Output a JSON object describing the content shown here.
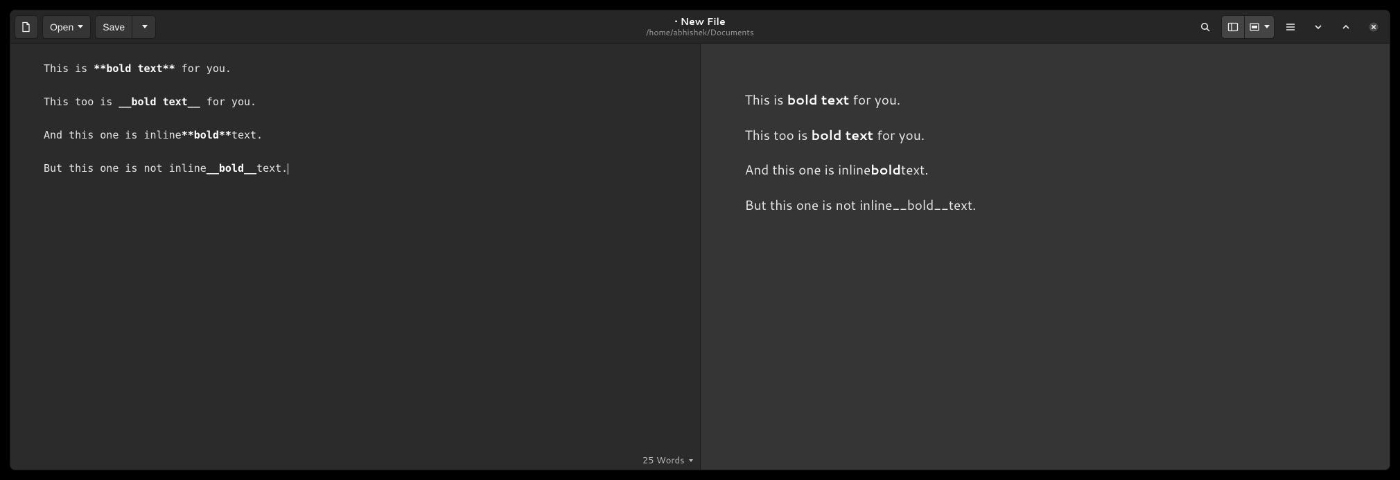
{
  "header": {
    "open_label": "Open",
    "save_label": "Save",
    "title": "• New File",
    "subtitle": "/home/abhishek/Documents"
  },
  "editor": {
    "lines": [
      {
        "segments": [
          {
            "t": "This is ",
            "s": "plain"
          },
          {
            "t": "**",
            "s": "delim"
          },
          {
            "t": "bold text",
            "s": "bold"
          },
          {
            "t": "**",
            "s": "delim"
          },
          {
            "t": " for you.",
            "s": "plain"
          }
        ]
      },
      {
        "segments": []
      },
      {
        "segments": [
          {
            "t": "This too is ",
            "s": "plain"
          },
          {
            "t": "__",
            "s": "delim"
          },
          {
            "t": "bold text",
            "s": "bold"
          },
          {
            "t": "__",
            "s": "delim"
          },
          {
            "t": " for you.",
            "s": "plain"
          }
        ]
      },
      {
        "segments": []
      },
      {
        "segments": [
          {
            "t": "And this one is inline",
            "s": "plain"
          },
          {
            "t": "**",
            "s": "delim"
          },
          {
            "t": "bold",
            "s": "bold"
          },
          {
            "t": "**",
            "s": "delim"
          },
          {
            "t": "text.",
            "s": "plain"
          }
        ]
      },
      {
        "segments": []
      },
      {
        "segments": [
          {
            "t": "But this one is not inline",
            "s": "plain"
          },
          {
            "t": "__",
            "s": "delim"
          },
          {
            "t": "bold",
            "s": "bold"
          },
          {
            "t": "__",
            "s": "delim"
          },
          {
            "t": "text.",
            "s": "plain"
          }
        ],
        "cursor_after": true
      }
    ],
    "word_count_label": "25 Words"
  },
  "preview": {
    "paragraphs": [
      [
        {
          "t": "This is ",
          "b": false
        },
        {
          "t": "bold text",
          "b": true
        },
        {
          "t": " for you.",
          "b": false
        }
      ],
      [
        {
          "t": "This too is ",
          "b": false
        },
        {
          "t": "bold text",
          "b": true
        },
        {
          "t": " for you.",
          "b": false
        }
      ],
      [
        {
          "t": "And this one is inline",
          "b": false
        },
        {
          "t": "bold",
          "b": true
        },
        {
          "t": "text.",
          "b": false
        }
      ],
      [
        {
          "t": "But this one is not inline__bold__text.",
          "b": false
        }
      ]
    ]
  },
  "icons": {
    "new_file": "new-file-icon",
    "search": "search-icon",
    "split": "sidebar-toggle-icon",
    "insert": "insert-icon",
    "menu": "hamburger-menu-icon",
    "down": "chevron-down-icon",
    "up": "chevron-up-icon",
    "close": "close-icon"
  }
}
